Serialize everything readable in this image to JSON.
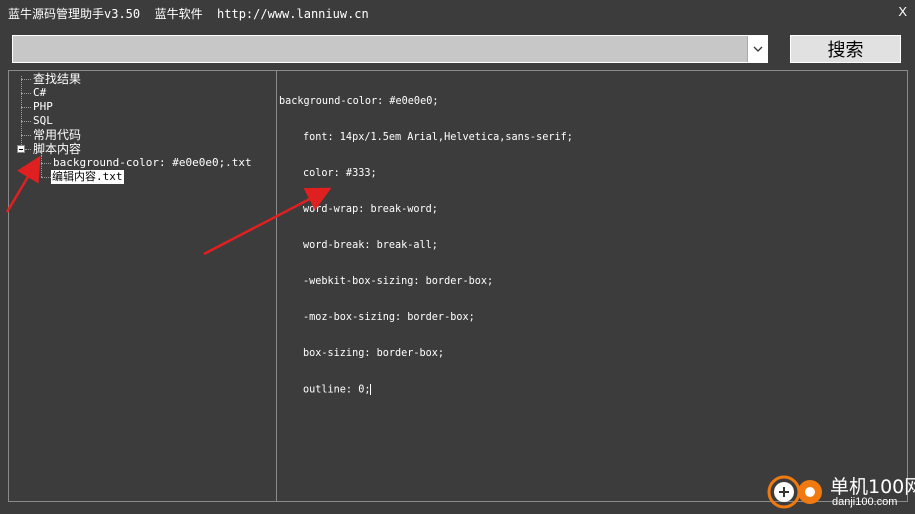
{
  "window": {
    "title": "蓝牛源码管理助手v3.50  蓝牛软件  http://www.lanniuw.cn",
    "close_label": "X"
  },
  "search": {
    "value": "",
    "placeholder": "",
    "button_label": "搜索"
  },
  "tree": {
    "items": [
      {
        "label": "查找结果"
      },
      {
        "label": "C#"
      },
      {
        "label": "PHP"
      },
      {
        "label": "SQL"
      },
      {
        "label": "常用代码"
      },
      {
        "label": "脚本内容",
        "expanded": true,
        "children": [
          {
            "label": "background-color: #e0e0e0;.txt"
          },
          {
            "label": "编辑内容.txt",
            "selected": true
          }
        ]
      }
    ]
  },
  "editor": {
    "lines": [
      "background-color: #e0e0e0;",
      "font: 14px/1.5em Arial,Helvetica,sans-serif;",
      "color: #333;",
      "word-wrap: break-word;",
      "word-break: break-all;",
      "-webkit-box-sizing: border-box;",
      "-moz-box-sizing: border-box;",
      "box-sizing: border-box;",
      "outline: 0;"
    ]
  },
  "watermark": {
    "cn": "单机100网",
    "en": "danji100.com"
  },
  "colors": {
    "background": "#3c3c3c",
    "annotation_arrow": "#e02020",
    "selection": "#ffffff"
  }
}
